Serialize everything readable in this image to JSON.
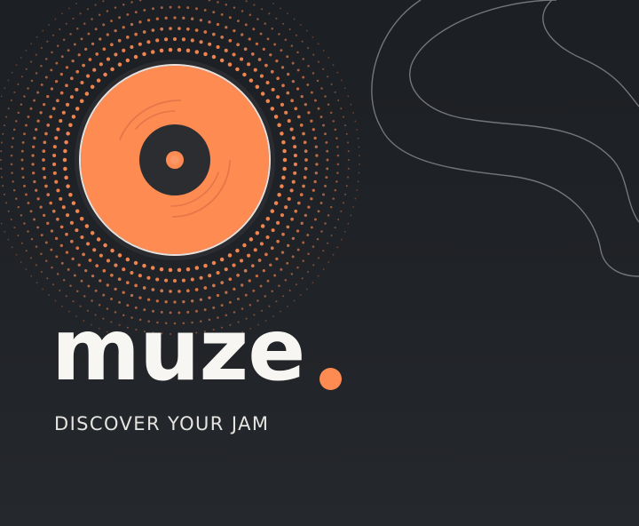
{
  "brand": {
    "name": "muze",
    "tagline": "DISCOVER YOUR JAM"
  },
  "colors": {
    "background": "#1f2226",
    "accent": "#fd8b52",
    "text": "#f7f6f3",
    "record_center": "#2b2d31",
    "line": "#72757a"
  },
  "icons": {
    "logo_mark": "vinyl-record-icon",
    "brand_dot": "dot-icon"
  }
}
